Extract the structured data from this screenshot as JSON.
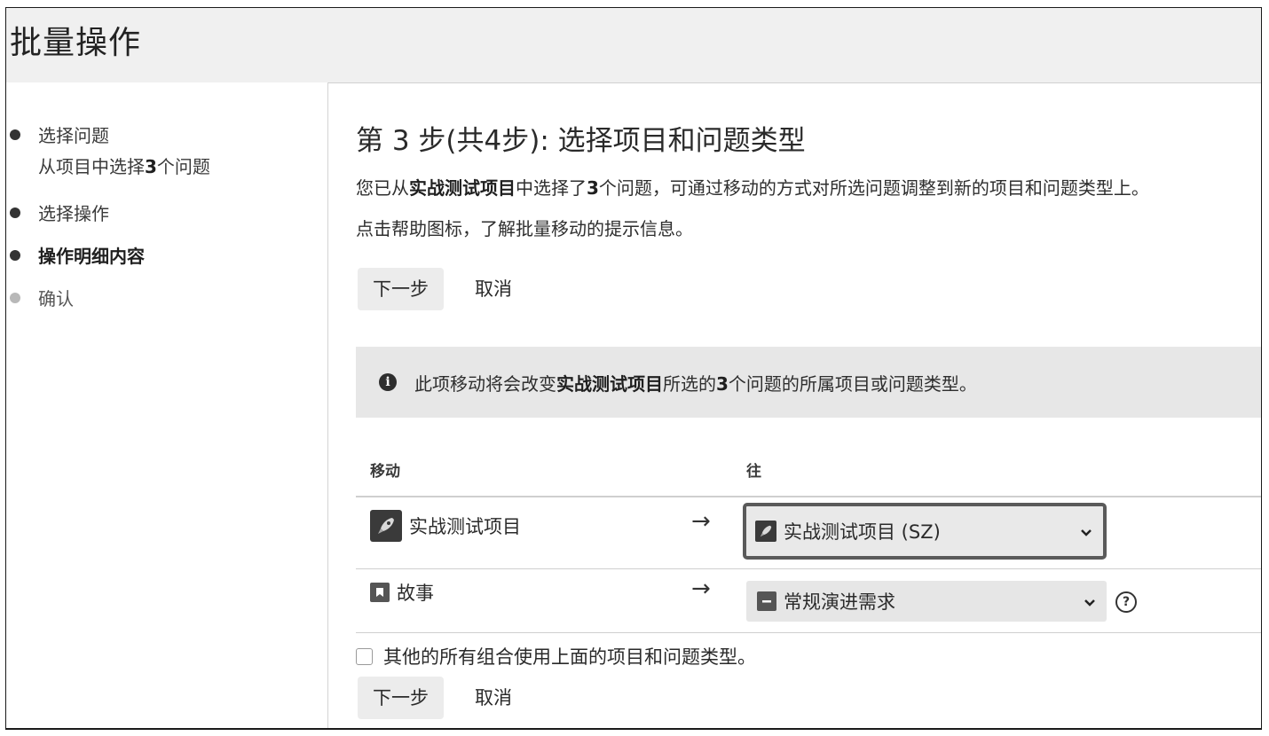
{
  "header": {
    "title": "批量操作"
  },
  "sidebar": {
    "steps": [
      {
        "label": "选择问题",
        "sub_prefix": "从项目中选择",
        "sub_count": "3",
        "sub_suffix": "个问题"
      },
      {
        "label": "选择操作"
      },
      {
        "label": "操作明细内容"
      },
      {
        "label": "确认"
      }
    ]
  },
  "main": {
    "title": "第 3 步(共4步): 选择项目和问题类型",
    "desc_prefix": "您已从",
    "desc_project": "实战测试项目",
    "desc_mid": "中选择了",
    "desc_count": "3",
    "desc_suffix": "个问题，可通过移动的方式对所选问题调整到新的项目和问题类型上。",
    "desc2": "点击帮助图标，了解批量移动的提示信息。",
    "next_label": "下一步",
    "cancel_label": "取消",
    "notice": {
      "prefix": "此项移动将会改变",
      "project": "实战测试项目",
      "mid": "所选的",
      "count": "3",
      "suffix": "个问题的所属项目或问题类型。"
    },
    "table": {
      "col_move": "移动",
      "col_to": "往",
      "arrow": "→",
      "rows": [
        {
          "from": "实战测试项目",
          "to": "实战测试项目 (SZ)"
        },
        {
          "from": "故事",
          "to": "常规演进需求"
        }
      ]
    },
    "checkbox_label": "其他的所有组合使用上面的项目和问题类型。"
  },
  "colors": {
    "header_bg": "#f0f0f0",
    "button_bg": "#ececec",
    "notice_bg": "#e7e7e7",
    "select_bg": "#e6e6e6"
  }
}
